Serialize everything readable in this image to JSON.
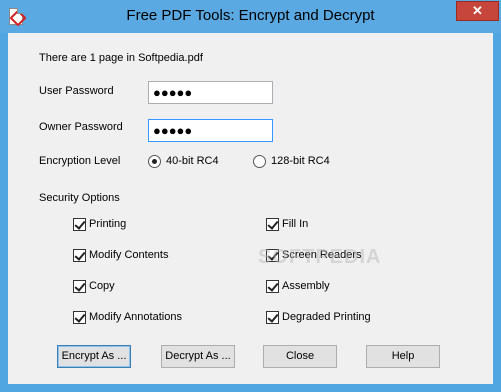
{
  "window": {
    "title": "Free PDF Tools:  Encrypt and Decrypt",
    "close_glyph": "✕"
  },
  "info": {
    "page_count_text": "There are 1 page in Softpedia.pdf"
  },
  "passwords": {
    "user_label": "User Password",
    "user_value": "●●●●●",
    "owner_label": "Owner Password",
    "owner_value": "●●●●●"
  },
  "encryption": {
    "label": "Encryption Level",
    "options": [
      {
        "label": "40-bit RC4",
        "selected": true
      },
      {
        "label": "128-bit RC4",
        "selected": false
      }
    ]
  },
  "security": {
    "label": "Security Options",
    "options": [
      {
        "label": "Printing",
        "checked": true
      },
      {
        "label": "Fill In",
        "checked": true
      },
      {
        "label": "Modify Contents",
        "checked": true
      },
      {
        "label": "Screen Readers",
        "checked": true
      },
      {
        "label": "Copy",
        "checked": true
      },
      {
        "label": "Assembly",
        "checked": true
      },
      {
        "label": "Modify Annotations",
        "checked": true
      },
      {
        "label": "Degraded Printing",
        "checked": true
      }
    ]
  },
  "buttons": {
    "encrypt": "Encrypt As ...",
    "decrypt": "Decrypt As ...",
    "close": "Close",
    "help": "Help"
  },
  "watermark": "SOFTPEDIA",
  "icons": {
    "app": "pdf-icon",
    "close": "close-icon"
  }
}
